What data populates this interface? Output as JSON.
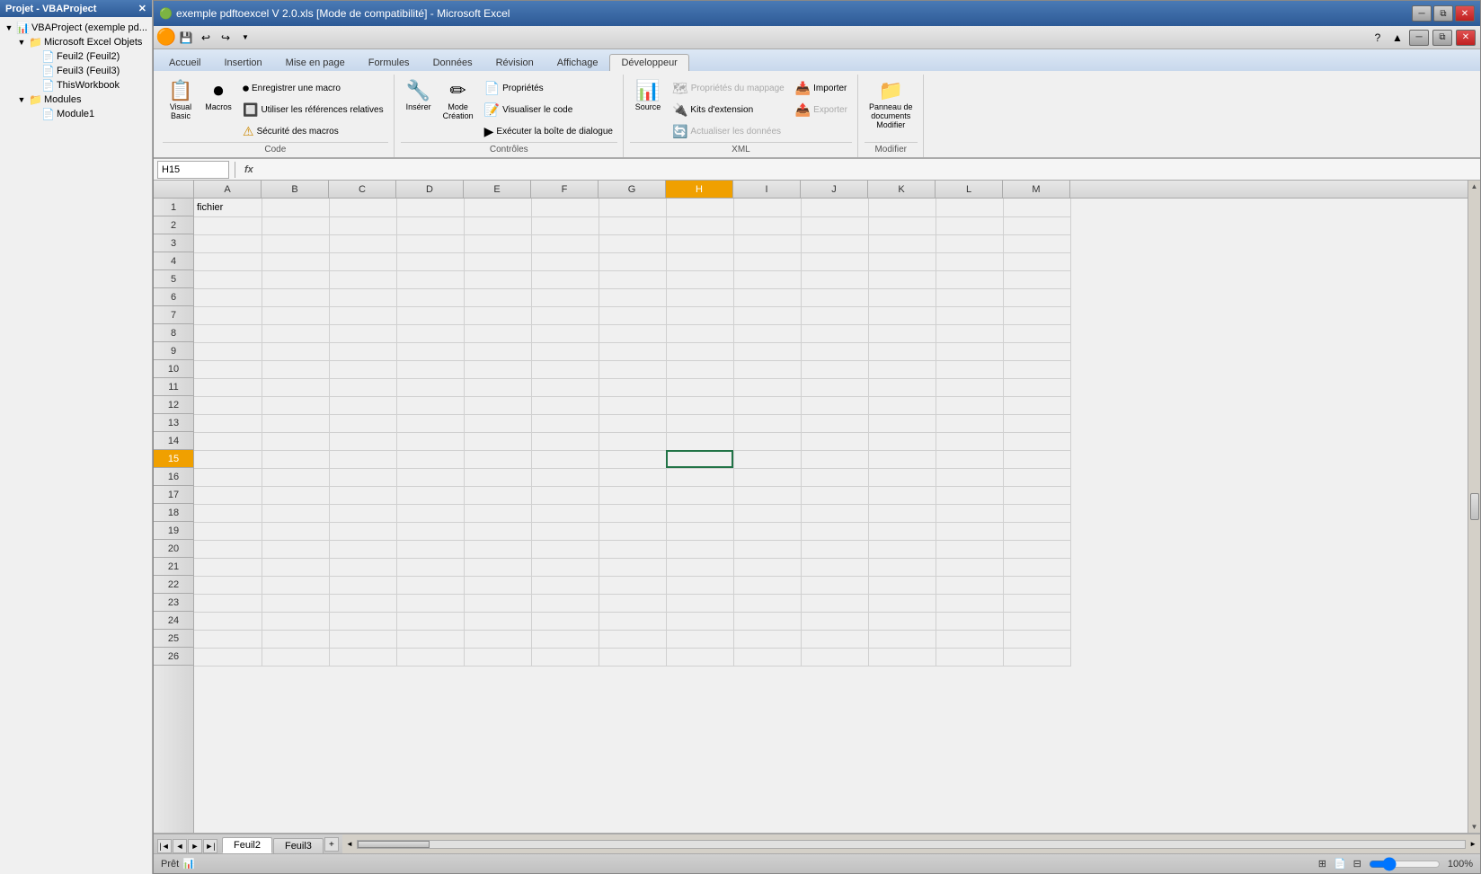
{
  "window": {
    "title": "exemple pdftoexcel V 2.0.xls [Mode de compatibilité] - Microsoft Excel",
    "titlebar_controls": [
      "minimize",
      "restore",
      "close"
    ]
  },
  "quickaccess": {
    "buttons": [
      "save",
      "undo",
      "redo",
      "dropdown"
    ]
  },
  "ribbon": {
    "tabs": [
      {
        "id": "accueil",
        "label": "Accueil"
      },
      {
        "id": "insertion",
        "label": "Insertion"
      },
      {
        "id": "mise-en-page",
        "label": "Mise en page"
      },
      {
        "id": "formules",
        "label": "Formules"
      },
      {
        "id": "donnees",
        "label": "Données"
      },
      {
        "id": "revision",
        "label": "Révision"
      },
      {
        "id": "affichage",
        "label": "Affichage"
      },
      {
        "id": "developpeur",
        "label": "Développeur",
        "active": true
      }
    ],
    "groups": {
      "code": {
        "label": "Code",
        "buttons": [
          {
            "id": "visual-basic",
            "label": "Visual\nBasic",
            "icon": "📋"
          },
          {
            "id": "macros",
            "label": "Macros",
            "icon": "⏺"
          }
        ],
        "smallButtons": [
          {
            "id": "enregistrer-macro",
            "label": "Enregistrer une macro"
          },
          {
            "id": "utiliser-ref",
            "label": "Utiliser les références relatives"
          },
          {
            "id": "securite-macros",
            "label": "⚠ Sécurité des macros",
            "warning": true
          }
        ]
      },
      "controles": {
        "label": "Contrôles",
        "buttons": [
          {
            "id": "inserer",
            "label": "Insérer",
            "icon": "🔧"
          },
          {
            "id": "mode-creation",
            "label": "Mode\nCréation",
            "icon": "✏"
          },
          {
            "id": "proprietes",
            "label": "Propriétés",
            "icon": "📄"
          },
          {
            "id": "visualiser-code",
            "label": "Visualiser le code",
            "icon": "📝"
          },
          {
            "id": "executer-boite",
            "label": "Exécuter la boîte de dialogue",
            "icon": "▶"
          }
        ]
      },
      "xml": {
        "label": "XML",
        "buttons": [
          {
            "id": "source",
            "label": "Source",
            "icon": "📊"
          }
        ],
        "smallButtons": [
          {
            "id": "proprietes-mappage",
            "label": "Propriétés du mappage",
            "disabled": true
          },
          {
            "id": "kits-extension",
            "label": "Kits d'extension"
          },
          {
            "id": "actualiser-donnees",
            "label": "Actualiser les données",
            "disabled": true
          },
          {
            "id": "importer",
            "label": "Importer"
          },
          {
            "id": "exporter",
            "label": "Exporter",
            "disabled": true
          }
        ]
      },
      "modifier": {
        "label": "Modifier",
        "buttons": [
          {
            "id": "panneau-documents",
            "label": "Panneau de\ndocuments\nModifier",
            "icon": "📁"
          }
        ]
      }
    }
  },
  "formulabar": {
    "namebox": "H15",
    "formula": ""
  },
  "leftpanel": {
    "header": "Projet - VBAProject",
    "tree": [
      {
        "id": "vbaproject",
        "label": "VBAProject (exemple pd...",
        "icon": "📊",
        "expanded": true,
        "children": [
          {
            "id": "excel-objets",
            "label": "Microsoft Excel Objets",
            "icon": "📁",
            "expanded": true,
            "children": [
              {
                "id": "feuil2",
                "label": "Feuil2 (Feuil2)",
                "icon": "📄"
              },
              {
                "id": "feuil3",
                "label": "Feuil3 (Feuil3)",
                "icon": "📄"
              },
              {
                "id": "thisworkbook",
                "label": "ThisWorkbook",
                "icon": "📄"
              }
            ]
          },
          {
            "id": "modules",
            "label": "Modules",
            "icon": "📁",
            "expanded": true,
            "children": [
              {
                "id": "module1",
                "label": "Module1",
                "icon": "📄"
              }
            ]
          }
        ]
      }
    ]
  },
  "spreadsheet": {
    "active_cell": "H15",
    "columns": [
      "A",
      "B",
      "C",
      "D",
      "E",
      "F",
      "G",
      "H",
      "I",
      "J",
      "K",
      "L",
      "M"
    ],
    "rows": 26,
    "selected_col": "H",
    "cell_data": {
      "A1": "fichier"
    }
  },
  "sheettabs": {
    "tabs": [
      {
        "id": "feuil2",
        "label": "Feuil2",
        "active": true
      },
      {
        "id": "feuil3",
        "label": "Feuil3",
        "active": false
      }
    ]
  },
  "statusbar": {
    "status": "Prêt",
    "ready_icon": "📊"
  }
}
